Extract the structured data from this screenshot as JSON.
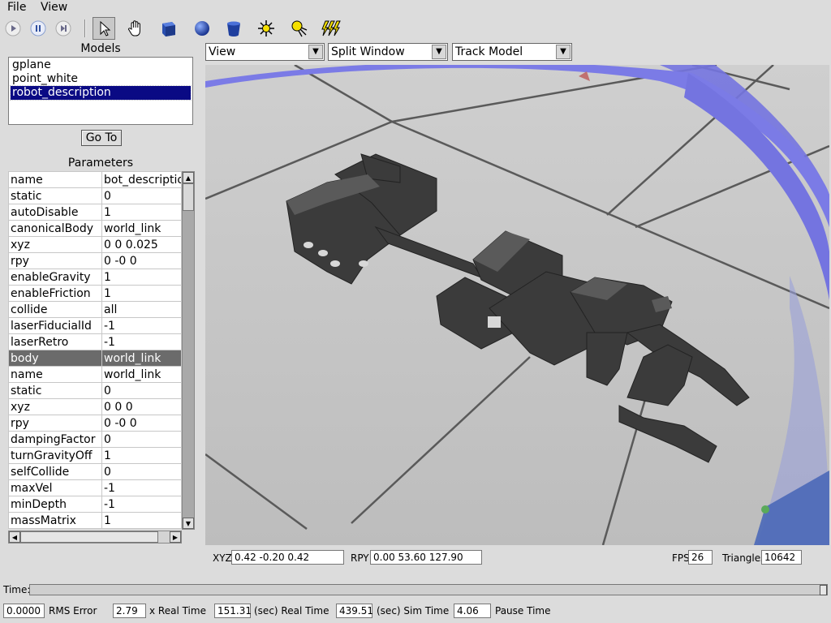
{
  "menu": {
    "file": "File",
    "view": "View"
  },
  "toolbar": {
    "buttons": [
      "play-icon",
      "pause-icon",
      "step-icon",
      "cursor-icon",
      "hand-icon",
      "box-icon",
      "sphere-icon",
      "cylinder-icon",
      "light-point-icon",
      "light-spot-icon",
      "light-directional-icon"
    ]
  },
  "models": {
    "title": "Models",
    "items": [
      "gplane",
      "point_white",
      "robot_description"
    ],
    "selected": "robot_description",
    "goto_label": "Go To"
  },
  "parameters": {
    "title": "Parameters",
    "rows": [
      {
        "key": "name",
        "value": "bot_descriptio"
      },
      {
        "key": "static",
        "value": "0"
      },
      {
        "key": "autoDisable",
        "value": "1"
      },
      {
        "key": "canonicalBody",
        "value": "world_link"
      },
      {
        "key": "xyz",
        "value": "0 0 0.025"
      },
      {
        "key": "rpy",
        "value": "0 -0 0"
      },
      {
        "key": "enableGravity",
        "value": "1"
      },
      {
        "key": "enableFriction",
        "value": "1"
      },
      {
        "key": "collide",
        "value": "all"
      },
      {
        "key": "laserFiducialId",
        "value": "-1"
      },
      {
        "key": "laserRetro",
        "value": "-1"
      },
      {
        "key": "body",
        "value": "world_link"
      },
      {
        "key": "name",
        "value": "world_link"
      },
      {
        "key": "static",
        "value": "0"
      },
      {
        "key": "xyz",
        "value": "0 0 0"
      },
      {
        "key": "rpy",
        "value": "0 -0 0"
      },
      {
        "key": "dampingFactor",
        "value": "0"
      },
      {
        "key": "turnGravityOff",
        "value": "1"
      },
      {
        "key": "selfCollide",
        "value": "0"
      },
      {
        "key": "maxVel",
        "value": "-1"
      },
      {
        "key": "minDepth",
        "value": "-1"
      },
      {
        "key": "massMatrix",
        "value": "1"
      }
    ],
    "highlight_row": 11
  },
  "viewport": {
    "view_combo": "View",
    "split_combo": "Split Window",
    "track_combo": "Track Model",
    "colors": {
      "ground": "#c9c9c9",
      "ring": "#7474e0",
      "robot": "#3b3b3b"
    }
  },
  "status": {
    "xyz_label": "XYZ",
    "xyz_value": "0.42  -0.20  0.42",
    "rpy_label": "RPY",
    "rpy_value": "0.00  53.60 127.90",
    "fps_label": "FPS",
    "fps_value": "26",
    "tri_label": "Triangles",
    "tri_value": "10642"
  },
  "time": {
    "label": "Time:"
  },
  "bottom": {
    "rms_value": "0.0000",
    "rms_label": "RMS Error",
    "xrt_value": "2.79",
    "xrt_label": "x Real Time",
    "rt_value": "151.31",
    "rt_label": "(sec) Real Time",
    "sim_value": "439.51",
    "sim_label": "(sec) Sim Time",
    "pause_value": "4.06",
    "pause_label": "Pause Time"
  }
}
